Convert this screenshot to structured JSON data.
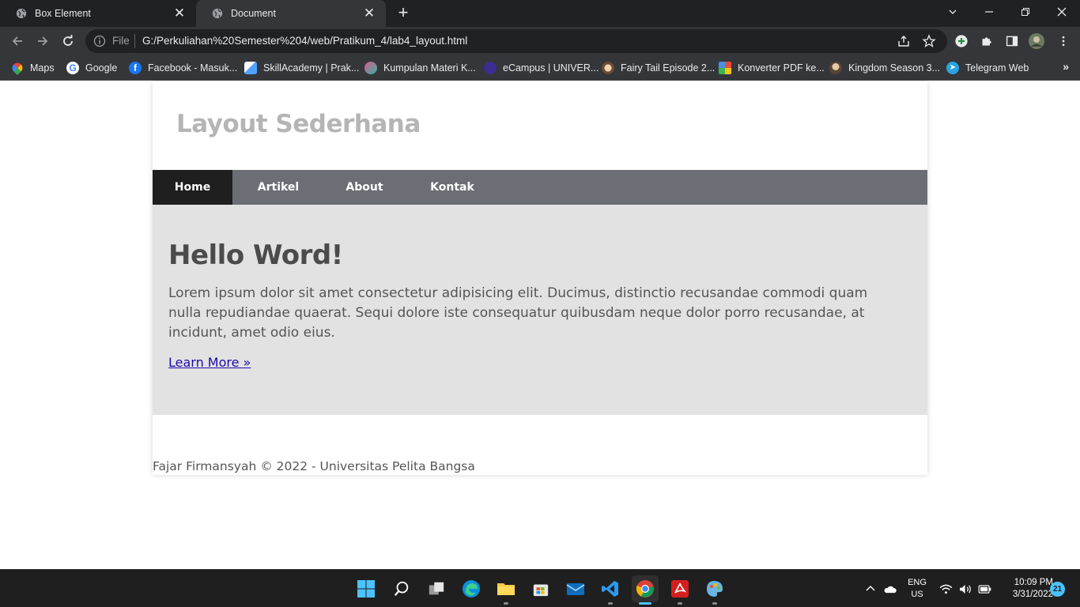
{
  "browser": {
    "tabs": [
      {
        "label": "Box Element",
        "active": false
      },
      {
        "label": "Document",
        "active": true
      }
    ],
    "address": {
      "scheme": "File",
      "url": "G:/Perkuliahan%20Semester%204/web/Pratikum_4/lab4_layout.html"
    },
    "bookmarks": [
      {
        "label": "Maps",
        "color": "#34a853"
      },
      {
        "label": "Google",
        "color": "#ffffff"
      },
      {
        "label": "Facebook - Masuk...",
        "color": "#1877f2"
      },
      {
        "label": "SkillAcademy | Prak...",
        "color": "#4fa3ff"
      },
      {
        "label": "Kumpulan Materi K...",
        "color": "#e05a8c"
      },
      {
        "label": "eCampus | UNIVER...",
        "color": "#3b2c8f"
      },
      {
        "label": "Fairy Tail Episode 2...",
        "color": "#c9a27a"
      },
      {
        "label": "Konverter PDF ke...",
        "color": "#e9c13b"
      },
      {
        "label": "Kingdom Season 3...",
        "color": "#b89272"
      },
      {
        "label": "Telegram Web",
        "color": "#2aa3e0"
      }
    ]
  },
  "page": {
    "site_title": "Layout Sederhana",
    "nav": [
      {
        "label": "Home",
        "active": true
      },
      {
        "label": "Artikel",
        "active": false
      },
      {
        "label": "About",
        "active": false
      },
      {
        "label": "Kontak",
        "active": false
      }
    ],
    "hero": {
      "title": "Hello Word!",
      "text": "Lorem ipsum dolor sit amet consectetur adipisicing elit. Ducimus, distinctio recusandae commodi quam nulla repudiandae quaerat. Sequi dolore iste consequatur quibusdam neque dolor porro recusandae, at incidunt, amet odio eius.",
      "link": "Learn More »"
    },
    "footer": "Fajar Firmansyah © 2022 - Universitas Pelita Bangsa"
  },
  "taskbar": {
    "apps": [
      "start",
      "search",
      "task-view",
      "edge",
      "file-explorer",
      "store",
      "mail",
      "vscode",
      "chrome",
      "acrobat",
      "paint"
    ],
    "active_app": "chrome",
    "lang_line1": "ENG",
    "lang_line2": "US",
    "time": "10:09 PM",
    "date": "3/31/2022",
    "notifications": "21"
  },
  "colors": {
    "nav_bg": "#6b6e74",
    "nav_active_bg": "#1f1f1f",
    "hero_bg": "#e2e2e2",
    "link": "#1a0dab",
    "taskbar_accent": "#4cc2ff"
  }
}
